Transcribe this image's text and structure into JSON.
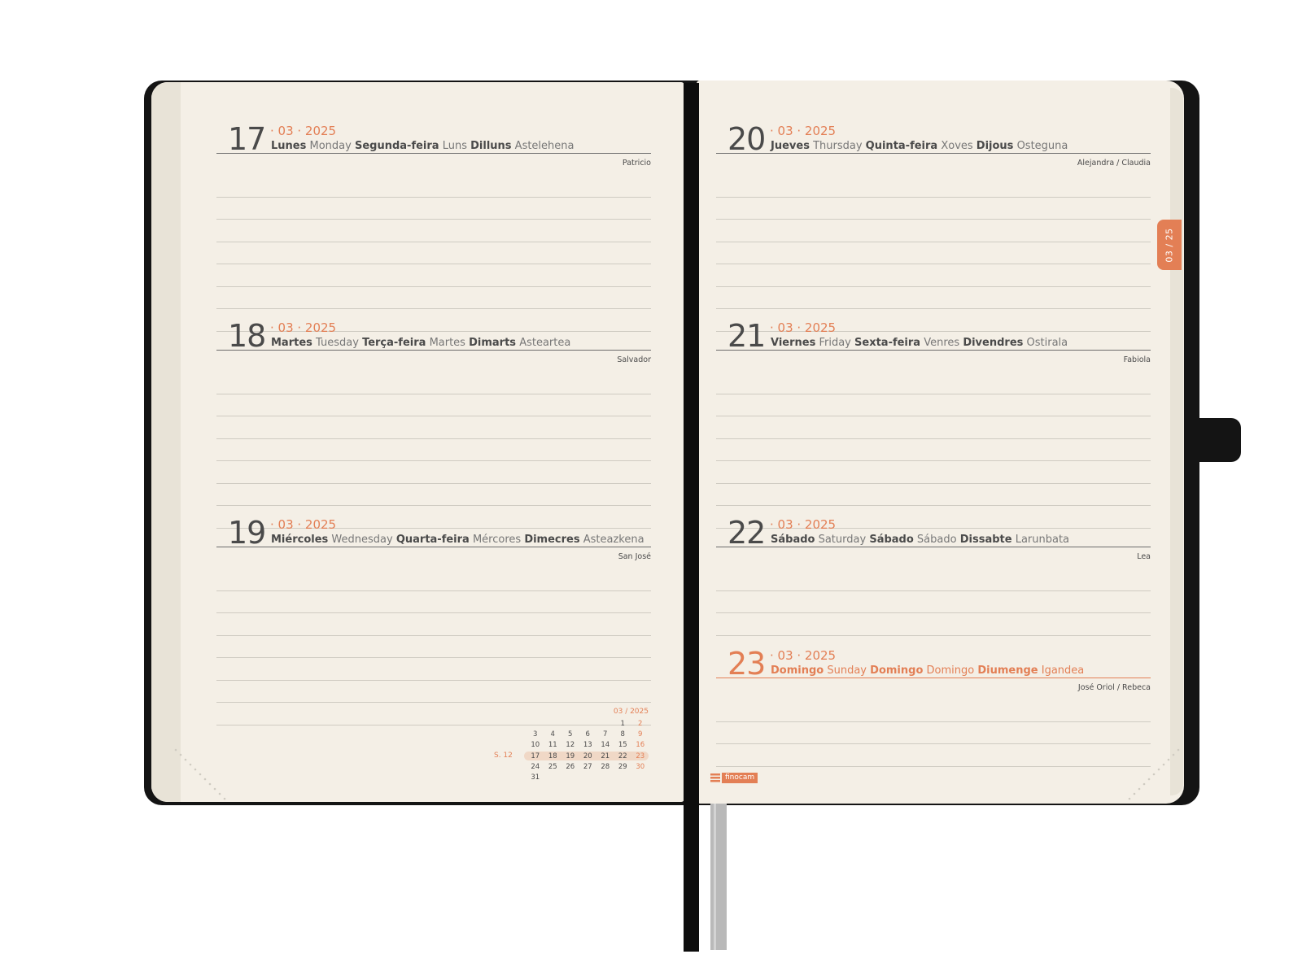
{
  "month_tab": "03 / 25",
  "days": [
    {
      "num": "17",
      "date": "· 03 · 2025",
      "weekdays": [
        [
          "b",
          "Lunes"
        ],
        [
          "l",
          "Monday"
        ],
        [
          "b",
          "Segunda-feira"
        ],
        [
          "l",
          "Luns"
        ],
        [
          "b",
          "Dilluns"
        ],
        [
          "l",
          "Astelehena"
        ]
      ],
      "saint": "Patricio"
    },
    {
      "num": "18",
      "date": "· 03 · 2025",
      "weekdays": [
        [
          "b",
          "Martes"
        ],
        [
          "l",
          "Tuesday"
        ],
        [
          "b",
          "Terça-feira"
        ],
        [
          "l",
          "Martes"
        ],
        [
          "b",
          "Dimarts"
        ],
        [
          "l",
          "Asteartea"
        ]
      ],
      "saint": "Salvador"
    },
    {
      "num": "19",
      "date": "· 03 · 2025",
      "weekdays": [
        [
          "b",
          "Miércoles"
        ],
        [
          "l",
          "Wednesday"
        ],
        [
          "b",
          "Quarta-feira"
        ],
        [
          "l",
          "Mércores"
        ],
        [
          "b",
          "Dimecres"
        ],
        [
          "l",
          "Asteazkena"
        ]
      ],
      "saint": "San José"
    },
    {
      "num": "20",
      "date": "· 03 · 2025",
      "weekdays": [
        [
          "b",
          "Jueves"
        ],
        [
          "l",
          "Thursday"
        ],
        [
          "b",
          "Quinta-feira"
        ],
        [
          "l",
          "Xoves"
        ],
        [
          "b",
          "Dijous"
        ],
        [
          "l",
          "Osteguna"
        ]
      ],
      "saint": "Alejandra / Claudia"
    },
    {
      "num": "21",
      "date": "· 03 · 2025",
      "weekdays": [
        [
          "b",
          "Viernes"
        ],
        [
          "l",
          "Friday"
        ],
        [
          "b",
          "Sexta-feira"
        ],
        [
          "l",
          "Venres"
        ],
        [
          "b",
          "Divendres"
        ],
        [
          "l",
          "Ostirala"
        ]
      ],
      "saint": "Fabiola"
    },
    {
      "num": "22",
      "date": "· 03 · 2025",
      "weekdays": [
        [
          "b",
          "Sábado"
        ],
        [
          "l",
          "Saturday"
        ],
        [
          "b",
          "Sábado"
        ],
        [
          "l",
          "Sábado"
        ],
        [
          "b",
          "Dissabte"
        ],
        [
          "l",
          "Larunbata"
        ]
      ],
      "saint": "Lea"
    },
    {
      "num": "23",
      "date": "· 03 · 2025",
      "weekdays": [
        [
          "b",
          "Domingo"
        ],
        [
          "l",
          "Sunday"
        ],
        [
          "b",
          "Domingo"
        ],
        [
          "l",
          "Domingo"
        ],
        [
          "b",
          "Diumenge"
        ],
        [
          "l",
          "Igandea"
        ]
      ],
      "saint": "José Oriol / Rebeca"
    }
  ],
  "mini_calendar": {
    "title": "03 / 2025",
    "week_label": "S. 12",
    "rows": [
      [
        "",
        "",
        "",
        "",
        "",
        "1",
        "2"
      ],
      [
        "3",
        "4",
        "5",
        "6",
        "7",
        "8",
        "9"
      ],
      [
        "10",
        "11",
        "12",
        "13",
        "14",
        "15",
        "16"
      ],
      [
        "17",
        "18",
        "19",
        "20",
        "21",
        "22",
        "23"
      ],
      [
        "24",
        "25",
        "26",
        "27",
        "28",
        "29",
        "30"
      ],
      [
        "31",
        "",
        "",
        "",
        "",
        "",
        ""
      ]
    ]
  },
  "brand": "finocam",
  "colors": {
    "accent": "#e37f55",
    "page": "#f4efe6",
    "cover": "#141414"
  }
}
